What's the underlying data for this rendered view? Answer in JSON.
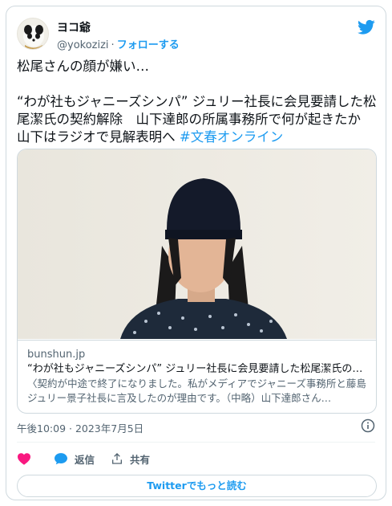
{
  "author": {
    "name": "ヨコ爺",
    "handle": "@yokozizi",
    "separator": "·",
    "follow_label": "フォローする"
  },
  "tweet": {
    "line1": "松尾さんの顔が嫌い…",
    "line2": "“わが社もジャニーズシンパ” ジュリー社長に会見要請した松尾潔氏の契約解除　山下達郎の所属事務所で何が起きたか　山下はラジオで見解表明へ ",
    "hashtag": "#文春オンライン"
  },
  "link_card": {
    "domain": "bunshun.jp",
    "title": "“わが社もジャニーズシンパ” ジュリー社長に会見要請した松尾潔氏の契…",
    "description": "〈契約が中途で終了になりました。私がメディアでジャニーズ事務所と藤島ジュリー景子社長に言及したのが理由です。（中略）山下達郎さん…"
  },
  "timestamp": "午後10:09 · 2023年7月5日",
  "actions": {
    "reply_label": "返信",
    "share_label": "共有"
  },
  "read_more_label": "Twitterでもっと読む",
  "colors": {
    "accent": "#1d9bf0",
    "like": "#f91880",
    "text": "#0f1419",
    "secondary": "#536471"
  }
}
